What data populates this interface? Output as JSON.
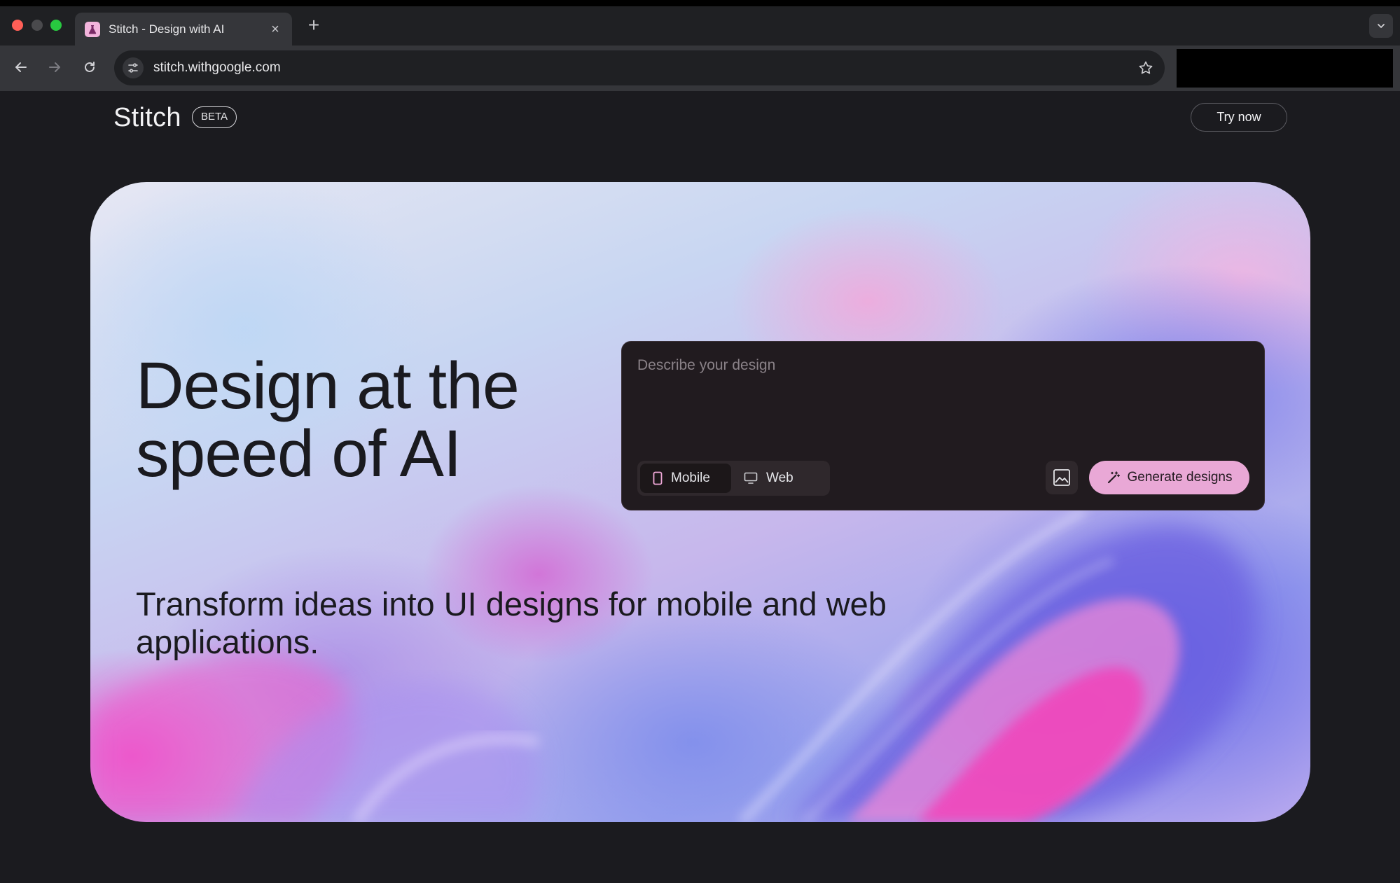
{
  "browser": {
    "tab_title": "Stitch - Design with AI",
    "tab_close": "×",
    "new_tab": "+",
    "url": "stitch.withgoogle.com"
  },
  "header": {
    "logo": "Stitch",
    "badge": "BETA",
    "cta": "Try now"
  },
  "hero": {
    "headline": "Design at the speed of AI",
    "subheadline": "Transform ideas into UI designs for mobile and web applications."
  },
  "prompt": {
    "placeholder": "Describe your design",
    "modes": [
      {
        "label": "Mobile",
        "icon": "phone-icon",
        "selected": true
      },
      {
        "label": "Web",
        "icon": "monitor-icon",
        "selected": false
      }
    ],
    "generate_label": "Generate designs"
  },
  "colors": {
    "accent": "#e9a8d6",
    "background": "#1b1b1f",
    "card": "#211b1f"
  }
}
